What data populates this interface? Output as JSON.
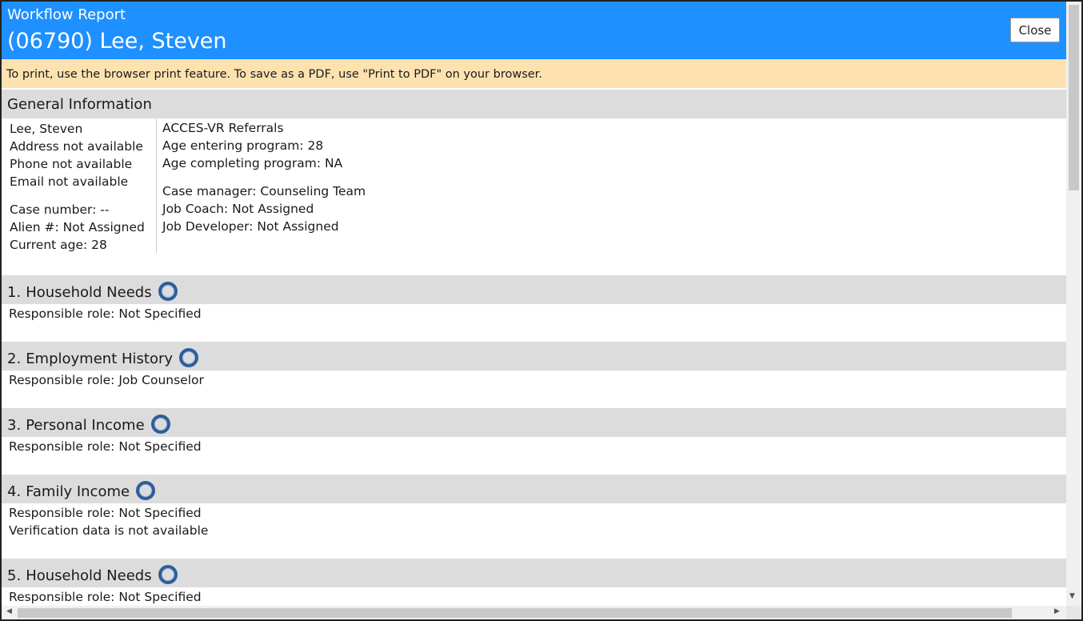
{
  "header": {
    "subtitle": "Workflow Report",
    "title": "(06790) Lee, Steven",
    "close_label": "Close"
  },
  "notice": "To print, use the browser print feature. To save as a PDF, use \"Print to PDF\" on your browser.",
  "general": {
    "heading": "General Information",
    "left_block1": [
      "Lee, Steven",
      "Address not available",
      "Phone not available",
      "Email not available"
    ],
    "left_block2": [
      "Case number: --",
      "Alien #: Not Assigned",
      "Current age: 28"
    ],
    "right_block1": [
      "ACCES-VR Referrals",
      "Age entering program: 28",
      "Age completing program: NA"
    ],
    "right_block2": [
      "Case manager: Counseling Team",
      "Job Coach: Not Assigned",
      "Job Developer: Not Assigned"
    ]
  },
  "steps": [
    {
      "num": "1.",
      "title": "Household Needs",
      "lines": [
        "Responsible role: Not Specified"
      ]
    },
    {
      "num": "2.",
      "title": "Employment History",
      "lines": [
        "Responsible role: Job Counselor"
      ]
    },
    {
      "num": "3.",
      "title": "Personal Income",
      "lines": [
        "Responsible role: Not Specified"
      ]
    },
    {
      "num": "4.",
      "title": "Family Income",
      "lines": [
        "Responsible role: Not Specified",
        "Verification data is not available"
      ]
    },
    {
      "num": "5.",
      "title": "Household Needs",
      "lines": [
        "Responsible role: Not Specified"
      ]
    }
  ],
  "icons": {
    "status": "status-circle-icon",
    "scroll_up": "arrow-up-icon",
    "scroll_down": "arrow-down-icon",
    "scroll_left": "arrow-left-icon",
    "scroll_right": "arrow-right-icon"
  },
  "colors": {
    "header": "#1e90ff",
    "notice": "#fde2b0",
    "section": "#dcdcdc",
    "status_ring": "#2d5f9a"
  }
}
